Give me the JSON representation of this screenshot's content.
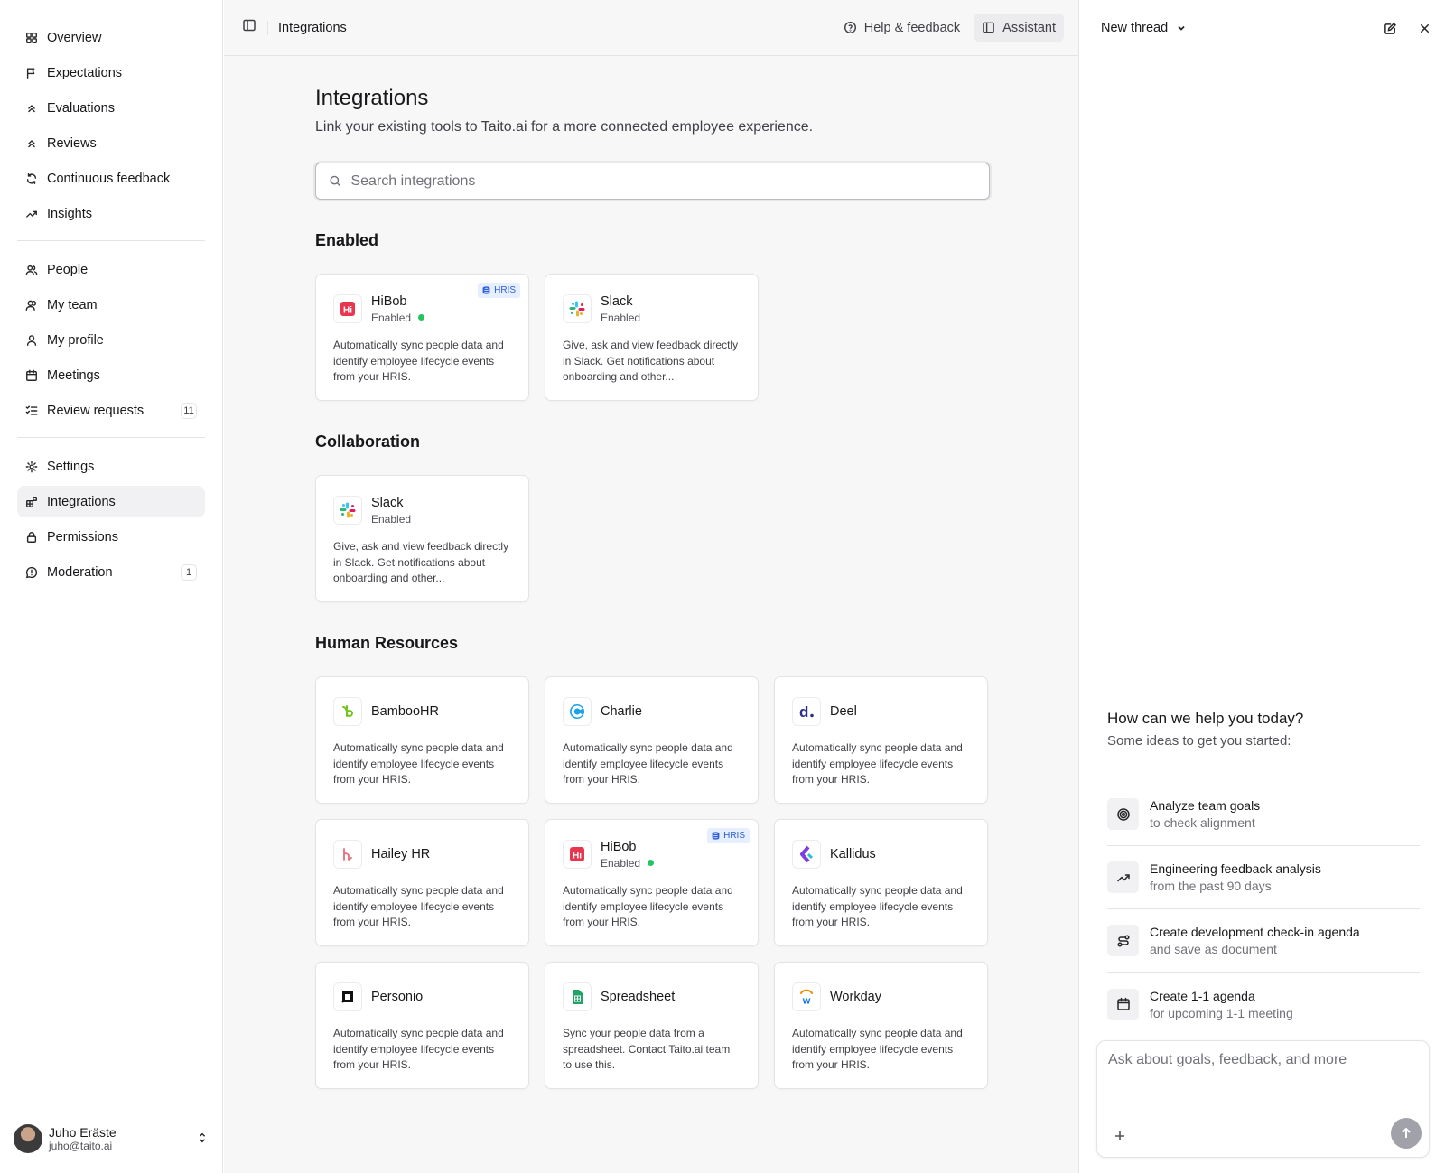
{
  "sidebar": {
    "primary": [
      {
        "label": "Overview",
        "icon": "grid-icon"
      },
      {
        "label": "Expectations",
        "icon": "flag-icon"
      },
      {
        "label": "Evaluations",
        "icon": "chevrons-up-icon"
      },
      {
        "label": "Reviews",
        "icon": "chevrons-up-icon"
      },
      {
        "label": "Continuous feedback",
        "icon": "refresh-icon"
      },
      {
        "label": "Insights",
        "icon": "trending-up-icon"
      }
    ],
    "secondary": [
      {
        "label": "People",
        "icon": "users-icon"
      },
      {
        "label": "My team",
        "icon": "user-team-icon"
      },
      {
        "label": "My profile",
        "icon": "user-icon"
      },
      {
        "label": "Meetings",
        "icon": "calendar-icon"
      },
      {
        "label": "Review requests",
        "icon": "list-check-icon",
        "count": "11"
      }
    ],
    "tertiary": [
      {
        "label": "Settings",
        "icon": "gear-icon"
      },
      {
        "label": "Integrations",
        "icon": "blocks-icon",
        "active": true
      },
      {
        "label": "Permissions",
        "icon": "lock-icon"
      },
      {
        "label": "Moderation",
        "icon": "message-alert-icon",
        "count": "1"
      }
    ],
    "user": {
      "name": "Juho Eräste",
      "email": "juho@taito.ai"
    }
  },
  "topbar": {
    "breadcrumb": "Integrations",
    "help_label": "Help & feedback",
    "assistant_label": "Assistant"
  },
  "page": {
    "title": "Integrations",
    "subtitle": "Link your existing tools to Taito.ai for a more connected employee experience.",
    "search_placeholder": "Search integrations"
  },
  "sections": [
    {
      "title": "Enabled",
      "cards": [
        {
          "name": "HiBob",
          "status": "Enabled",
          "dot": true,
          "badge": "HRIS",
          "logo": "hibob",
          "desc": "Automatically sync people data and identify employee lifecycle events from your HRIS."
        },
        {
          "name": "Slack",
          "status": "Enabled",
          "dot": false,
          "badge": "",
          "logo": "slack",
          "desc": "Give, ask and view feedback directly in Slack. Get notifications about onboarding and other..."
        }
      ]
    },
    {
      "title": "Collaboration",
      "cards": [
        {
          "name": "Slack",
          "status": "Enabled",
          "dot": false,
          "badge": "",
          "logo": "slack",
          "desc": "Give, ask and view feedback directly in Slack. Get notifications about onboarding and other..."
        }
      ]
    },
    {
      "title": "Human Resources",
      "cards": [
        {
          "name": "BambooHR",
          "status": "",
          "dot": false,
          "badge": "",
          "logo": "bamboohr",
          "desc": "Automatically sync people data and identify employee lifecycle events from your HRIS."
        },
        {
          "name": "Charlie",
          "status": "",
          "dot": false,
          "badge": "",
          "logo": "charlie",
          "desc": "Automatically sync people data and identify employee lifecycle events from your HRIS."
        },
        {
          "name": "Deel",
          "status": "",
          "dot": false,
          "badge": "",
          "logo": "deel",
          "desc": "Automatically sync people data and identify employee lifecycle events from your HRIS."
        },
        {
          "name": "Hailey HR",
          "status": "",
          "dot": false,
          "badge": "",
          "logo": "hailey",
          "desc": "Automatically sync people data and identify employee lifecycle events from your HRIS."
        },
        {
          "name": "HiBob",
          "status": "Enabled",
          "dot": true,
          "badge": "HRIS",
          "logo": "hibob",
          "desc": "Automatically sync people data and identify employee lifecycle events from your HRIS."
        },
        {
          "name": "Kallidus",
          "status": "",
          "dot": false,
          "badge": "",
          "logo": "kallidus",
          "desc": "Automatically sync people data and identify employee lifecycle events from your HRIS."
        },
        {
          "name": "Personio",
          "status": "",
          "dot": false,
          "badge": "",
          "logo": "personio",
          "desc": "Automatically sync people data and identify employee lifecycle events from your HRIS."
        },
        {
          "name": "Spreadsheet",
          "status": "",
          "dot": false,
          "badge": "",
          "logo": "spreadsheet",
          "desc": "Sync your people data from a spreadsheet. Contact Taito.ai team to use this."
        },
        {
          "name": "Workday",
          "status": "",
          "dot": false,
          "badge": "",
          "logo": "workday",
          "desc": "Automatically sync people data and identify employee lifecycle events from your HRIS."
        }
      ]
    }
  ],
  "assistant": {
    "thread_label": "New thread",
    "help_title": "How can we help you today?",
    "help_subtitle": "Some ideas to get you started:",
    "suggestions": [
      {
        "title": "Analyze team goals",
        "subtitle": "to check alignment",
        "icon": "target-icon"
      },
      {
        "title": "Engineering feedback analysis",
        "subtitle": "from the past 90 days",
        "icon": "trending-up-icon"
      },
      {
        "title": "Create development check-in agenda",
        "subtitle": "and save as document",
        "icon": "route-icon"
      },
      {
        "title": "Create 1-1 agenda",
        "subtitle": "for upcoming 1-1 meeting",
        "icon": "calendar-icon"
      }
    ],
    "composer_placeholder": "Ask about goals, feedback, and more"
  }
}
